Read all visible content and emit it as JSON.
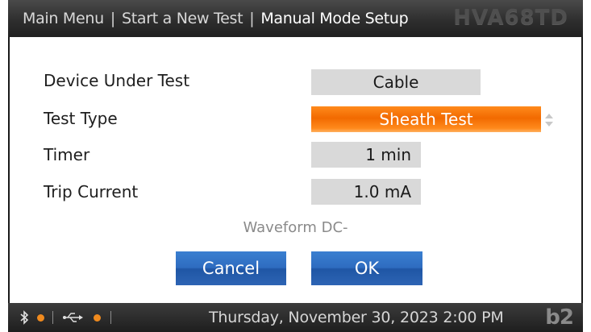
{
  "header": {
    "breadcrumbs": [
      "Main Menu",
      "Start a New Test",
      "Manual Mode Setup"
    ],
    "separator": "|",
    "model": "HVA68TD"
  },
  "form": {
    "device_under_test": {
      "label": "Device Under Test",
      "value": "Cable"
    },
    "test_type": {
      "label": "Test Type",
      "value": "Sheath Test"
    },
    "timer": {
      "label": "Timer",
      "value": "1 min"
    },
    "trip_current": {
      "label": "Trip Current",
      "value": "1.0 mA"
    }
  },
  "waveform_text": "Waveform DC-",
  "buttons": {
    "cancel": "Cancel",
    "ok": "OK"
  },
  "footer": {
    "icons": [
      "bluetooth-icon",
      "usb-icon"
    ],
    "datetime": "Thursday, November 30, 2023 2:00 PM",
    "brand": "b2"
  },
  "colors": {
    "accent_orange": "#f26a00",
    "button_blue": "#2e6cc0",
    "field_gray": "#d9d9d9",
    "header_dark": "#2e2e2e",
    "status_dot": "#f08a1e"
  }
}
